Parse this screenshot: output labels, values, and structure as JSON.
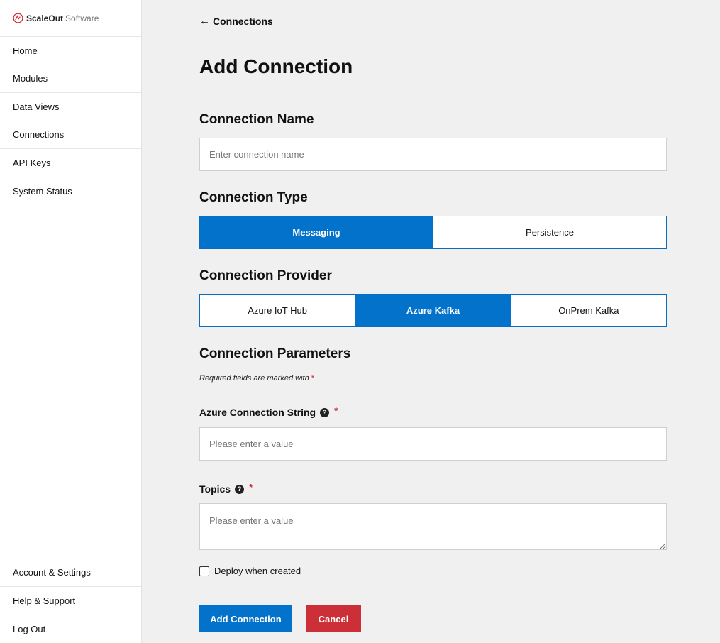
{
  "brand": {
    "name_bold": "ScaleOut",
    "name_light": "Software",
    "accent": "#d0232b"
  },
  "sidebar": {
    "items": [
      {
        "label": "Home"
      },
      {
        "label": "Modules"
      },
      {
        "label": "Data Views"
      },
      {
        "label": "Connections"
      },
      {
        "label": "API Keys"
      },
      {
        "label": "System Status"
      }
    ],
    "bottom_items": [
      {
        "label": "Account & Settings"
      },
      {
        "label": "Help & Support"
      },
      {
        "label": "Log Out"
      }
    ]
  },
  "header": {
    "back_label": "Connections",
    "title": "Add Connection"
  },
  "connection_name": {
    "heading": "Connection Name",
    "placeholder": "Enter connection name",
    "value": ""
  },
  "connection_type": {
    "heading": "Connection Type",
    "options": [
      "Messaging",
      "Persistence"
    ],
    "selected": "Messaging"
  },
  "connection_provider": {
    "heading": "Connection Provider",
    "options": [
      "Azure IoT Hub",
      "Azure Kafka",
      "OnPrem Kafka"
    ],
    "selected": "Azure Kafka"
  },
  "parameters": {
    "heading": "Connection Parameters",
    "required_note": "Required fields are marked with",
    "required_mark": "*",
    "azure_connection_string": {
      "label": "Azure Connection String",
      "placeholder": "Please enter a value",
      "value": ""
    },
    "topics": {
      "label": "Topics",
      "placeholder": "Please enter a value",
      "value": ""
    }
  },
  "deploy_checkbox": {
    "label": "Deploy when created",
    "checked": false
  },
  "actions": {
    "submit_label": "Add Connection",
    "cancel_label": "Cancel"
  },
  "colors": {
    "primary": "#0272cb",
    "danger": "#cd2f38",
    "background": "#f0f0f0"
  }
}
